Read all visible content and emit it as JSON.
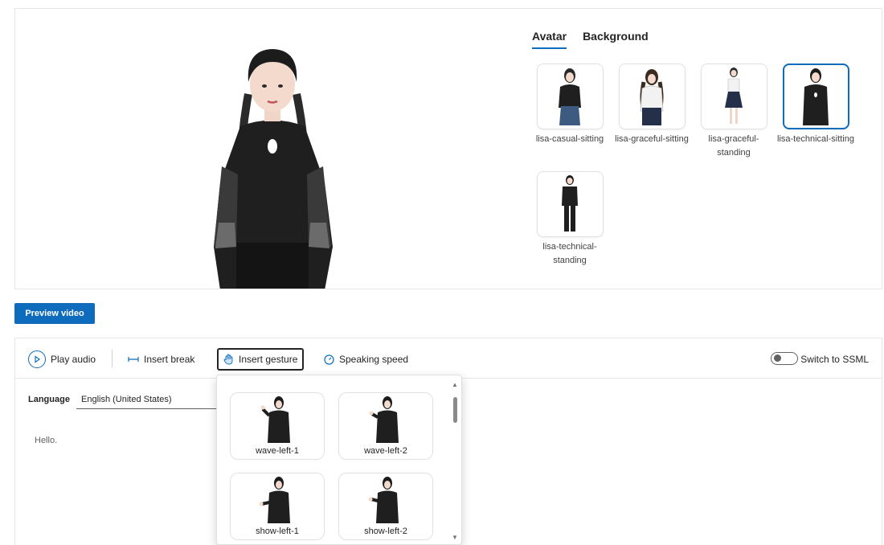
{
  "tabs": {
    "avatar": "Avatar",
    "background": "Background"
  },
  "avatars": [
    {
      "label": "lisa-casual-sitting",
      "selected": false
    },
    {
      "label": "lisa-graceful-sitting",
      "selected": false
    },
    {
      "label": "lisa-graceful-standing",
      "selected": false
    },
    {
      "label": "lisa-technical-sitting",
      "selected": true
    },
    {
      "label": "lisa-technical-standing",
      "selected": false
    }
  ],
  "preview_button": "Preview video",
  "toolbar": {
    "play_audio": "Play audio",
    "insert_break": "Insert break",
    "insert_gesture": "Insert gesture",
    "speaking_speed": "Speaking speed",
    "switch_ssml": "Switch to SSML"
  },
  "language": {
    "label": "Language",
    "value": "English (United States)"
  },
  "editor_text": "Hello.",
  "gestures": [
    {
      "label": "wave-left-1"
    },
    {
      "label": "wave-left-2"
    },
    {
      "label": "show-left-1"
    },
    {
      "label": "show-left-2"
    }
  ],
  "colors": {
    "accent": "#0f6cbd",
    "outfit": "#1f1f1f"
  }
}
